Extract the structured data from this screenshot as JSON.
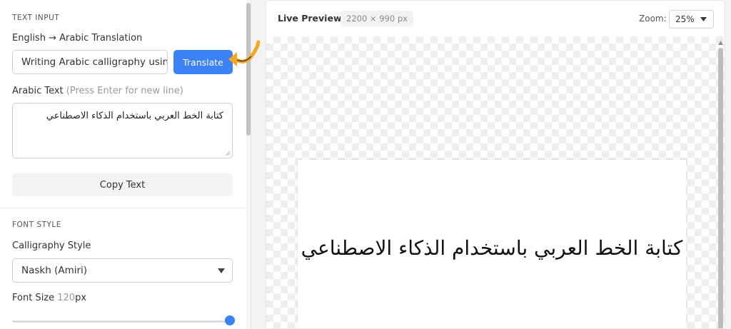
{
  "text_input": {
    "heading": "TEXT INPUT",
    "translation_label": "English → Arabic Translation",
    "english_value": "Writing Arabic calligraphy using",
    "translate_button": "Translate",
    "arabic_label": "Arabic Text",
    "arabic_hint": "(Press Enter for new line)",
    "arabic_value": "كتابة الخط العربي باستخدام الذكاء الاصطناعي",
    "copy_button": "Copy Text"
  },
  "font_style": {
    "heading": "FONT STYLE",
    "style_label": "Calligraphy Style",
    "style_selected": "Naskh (Amiri)",
    "size_label": "Font Size",
    "size_value": "120",
    "size_unit": "px",
    "size_slider_fraction": 1.0
  },
  "preview": {
    "title": "Live Preview",
    "dimensions": "2200 × 990 px",
    "zoom_label": "Zoom:",
    "zoom_value": "25%",
    "canvas_text": "كتابة الخط العربي باستخدام الذكاء الاصطناعي"
  },
  "icons": {
    "arrow": "hand-drawn-arrow-icon",
    "select_caret": "chevron-down-icon",
    "zoom_caret": "chevron-down-icon",
    "resize": "resize-grip-icon",
    "scroll_up": "scroll-up-arrow-icon"
  },
  "colors": {
    "accent": "#3b82f6",
    "arrow": "#f5a623",
    "canvas_bg": "#ffffff"
  }
}
